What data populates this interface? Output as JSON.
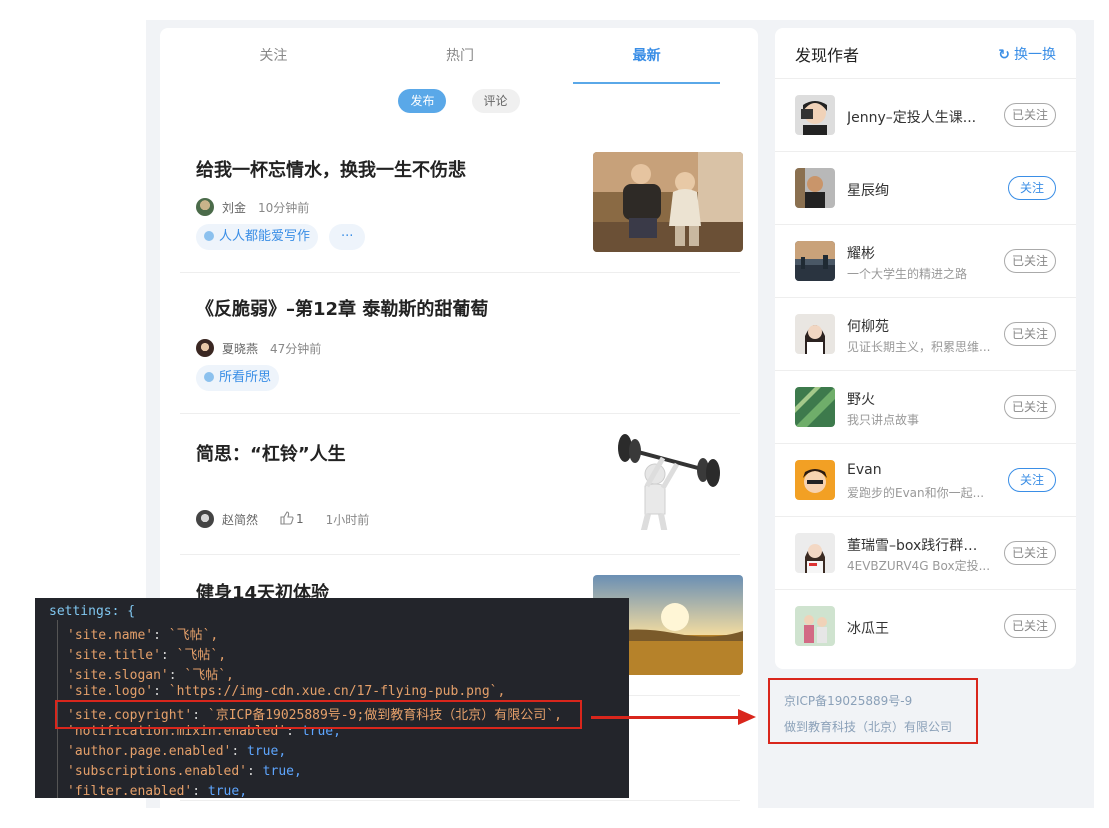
{
  "tabs": [
    "关注",
    "热门",
    "最新"
  ],
  "sub_tabs": [
    "发布",
    "评论"
  ],
  "articles": [
    {
      "title": "给我一杯忘情水，换我一生不伤悲",
      "author": "刘金",
      "time": "10分钟前",
      "tags": [
        "人人都能爱写作",
        "···"
      ]
    },
    {
      "title": "《反脆弱》–第12章 泰勒斯的甜葡萄",
      "author": "夏晓燕",
      "time": "47分钟前",
      "tags": [
        "所看所思"
      ]
    },
    {
      "title": "简思：“杠铃”人生",
      "author": "赵简然",
      "likes": "1",
      "time": "1小时前"
    },
    {
      "title": "健身14天初体验"
    }
  ],
  "sidebar": {
    "title": "发现作者",
    "refresh": "换一换",
    "authors": [
      {
        "name": "Jenny–定投人生课...",
        "desc": "",
        "button": "已关注"
      },
      {
        "name": "星辰绚",
        "desc": "",
        "button": "关注"
      },
      {
        "name": "耀彬",
        "desc": "一个大学生的精进之路",
        "button": "已关注"
      },
      {
        "name": "何柳苑",
        "desc": "见证长期主义，积累思维...",
        "button": "已关注"
      },
      {
        "name": "野火",
        "desc": "我只讲点故事",
        "button": "已关注"
      },
      {
        "name": "Evan",
        "desc": "爱跑步的Evan和你一起...",
        "button": "关注"
      },
      {
        "name": "董瑞雪–box践行群服务",
        "desc": "4EVBZURV4G Box定投...",
        "button": "已关注"
      },
      {
        "name": "冰瓜王",
        "desc": "",
        "button": "已关注"
      }
    ]
  },
  "footer": {
    "icp": "京ICP备19025889号-9",
    "company": "做到教育科技（北京）有限公司"
  },
  "code": {
    "header": "settings: {",
    "lines": [
      {
        "key": "'site.name'",
        "val": "`飞帖`,"
      },
      {
        "key": "'site.title'",
        "val": "`飞帖`,"
      },
      {
        "key": "'site.slogan'",
        "val": "`飞帖`,"
      },
      {
        "key": "'site.logo'",
        "val": "`https://img-cdn.xue.cn/17-flying-pub.png`,"
      },
      {
        "key": "'site.copyright'",
        "val": "`京ICP备19025889号-9;做到教育科技（北京）有限公司`,"
      },
      {
        "key": "'notification.mixin.enabled'",
        "val": "true,"
      },
      {
        "key": "'author.page.enabled'",
        "val": "true,"
      },
      {
        "key": "'subscriptions.enabled'",
        "val": "true,"
      },
      {
        "key": "'filter.enabled'",
        "val": "true,"
      }
    ]
  }
}
